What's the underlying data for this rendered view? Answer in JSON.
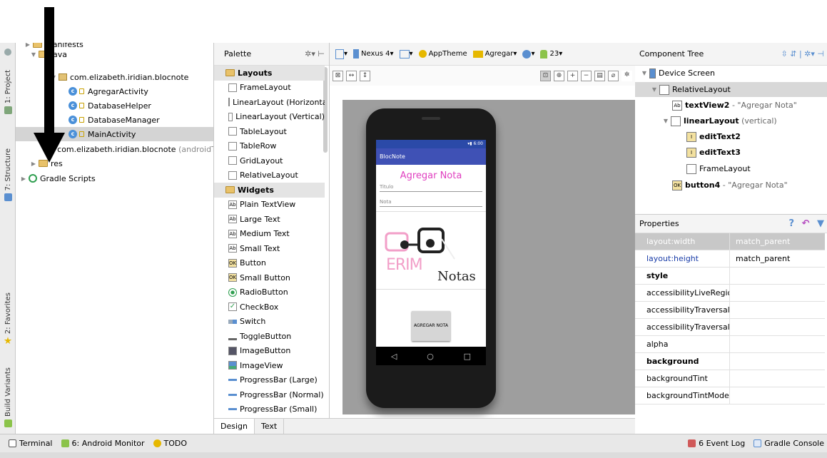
{
  "left_strip": {
    "project_label": "1: Project",
    "structure_label": "7: Structure",
    "favorites_label": "2: Favorites",
    "build_variants_label": "Build Variants"
  },
  "project_tree": {
    "manifests_label": "manifests",
    "java_label": "java",
    "package_main": "com.elizabeth.iridian.blocnote",
    "classes": [
      "AgregarActivity",
      "DatabaseHelper",
      "DatabaseManager",
      "MainActivity"
    ],
    "package_test": "com.elizabeth.iridian.blocnote",
    "package_test_suffix": "(androidTest)",
    "res_label": "res",
    "gradle_label": "Gradle Scripts"
  },
  "palette": {
    "title": "Palette",
    "layouts_title": "Layouts",
    "layouts": [
      "FrameLayout",
      "LinearLayout (Horizontal)",
      "LinearLayout (Vertical)",
      "TableLayout",
      "TableRow",
      "GridLayout",
      "RelativeLayout"
    ],
    "widgets_title": "Widgets",
    "widgets": [
      "Plain TextView",
      "Large Text",
      "Medium Text",
      "Small Text",
      "Button",
      "Small Button",
      "RadioButton",
      "CheckBox",
      "Switch",
      "ToggleButton",
      "ImageButton",
      "ImageView",
      "ProgressBar (Large)",
      "ProgressBar (Normal)",
      "ProgressBar (Small)"
    ]
  },
  "design_toolbar": {
    "device": "Nexus 4",
    "theme": "AppTheme",
    "activity": "Agregar",
    "api": "23"
  },
  "preview": {
    "status_time": "6:00",
    "app_name": "BlocNote",
    "title": "Agregar Nota",
    "field1_hint": "Titulo",
    "field2_hint": "Nota",
    "logo_text1": "ERIM",
    "logo_text2": "Notas",
    "button_label": "AGREGAR NOTA",
    "nav_back": "◁",
    "nav_home": "○",
    "nav_recent": "□"
  },
  "component_tree": {
    "title": "Component Tree",
    "device_screen": "Device Screen",
    "relative_layout": "RelativeLayout",
    "textview_id": "textView2",
    "textview_text": "- \"Agregar Nota\"",
    "linear_layout_id": "linearLayout",
    "linear_layout_suffix": "(vertical)",
    "edit1": "editText2",
    "edit2": "editText3",
    "frame_layout": "FrameLayout",
    "button_id": "button4",
    "button_text": "- \"Agregar Nota\""
  },
  "properties": {
    "title": "Properties",
    "rows": [
      {
        "key": "layout:width",
        "value": "match_parent"
      },
      {
        "key": "layout:height",
        "value": "match_parent"
      },
      {
        "key": "style",
        "value": ""
      },
      {
        "key": "accessibilityLiveRegion",
        "value": ""
      },
      {
        "key": "accessibilityTraversalAfte",
        "value": ""
      },
      {
        "key": "accessibilityTraversalBefc",
        "value": ""
      },
      {
        "key": "alpha",
        "value": ""
      },
      {
        "key": "background",
        "value": ""
      },
      {
        "key": "backgroundTint",
        "value": ""
      },
      {
        "key": "backgroundTintMode",
        "value": ""
      }
    ]
  },
  "design_tabs": {
    "design": "Design",
    "text": "Text"
  },
  "bottom_bar": {
    "terminal": "Terminal",
    "android_monitor": "6: Android Monitor",
    "todo": "TODO",
    "event_log": "Event Log",
    "event_log_count": "6",
    "gradle_console": "Gradle Console"
  },
  "colors": {
    "accent_pink": "#e040c0",
    "appbar_blue": "#3f51b5",
    "link_blue": "#1a3da8"
  }
}
